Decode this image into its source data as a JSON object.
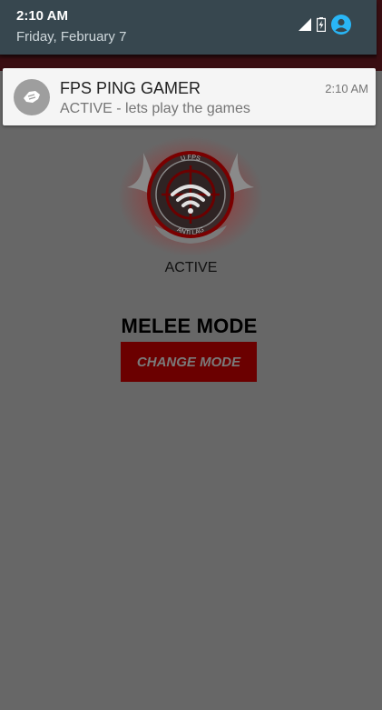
{
  "colors": {
    "scrim": "#676767",
    "shade_header": "#37474f",
    "app_bar": "#3a0e12",
    "accent_red": "#6b0000",
    "account_icon": "#29b6f6"
  },
  "status_bar": {
    "time": "2:10 AM",
    "date": "Friday, February 7",
    "icons": [
      "signal-icon",
      "battery-charging-icon",
      "account-icon"
    ]
  },
  "notification": {
    "app_icon": "app-logo-icon",
    "title": "FPS PING GAMER",
    "text": "ACTIVE - lets play the games",
    "time": "2:10 AM"
  },
  "app": {
    "logo": {
      "icon": "wifi-crosshair-logo",
      "top_text": "U FPS",
      "bottom_text": "ANTI LAG"
    },
    "status_label": "ACTIVE",
    "mode_title": "MELEE MODE",
    "change_mode_label": "CHANGE MODE"
  }
}
